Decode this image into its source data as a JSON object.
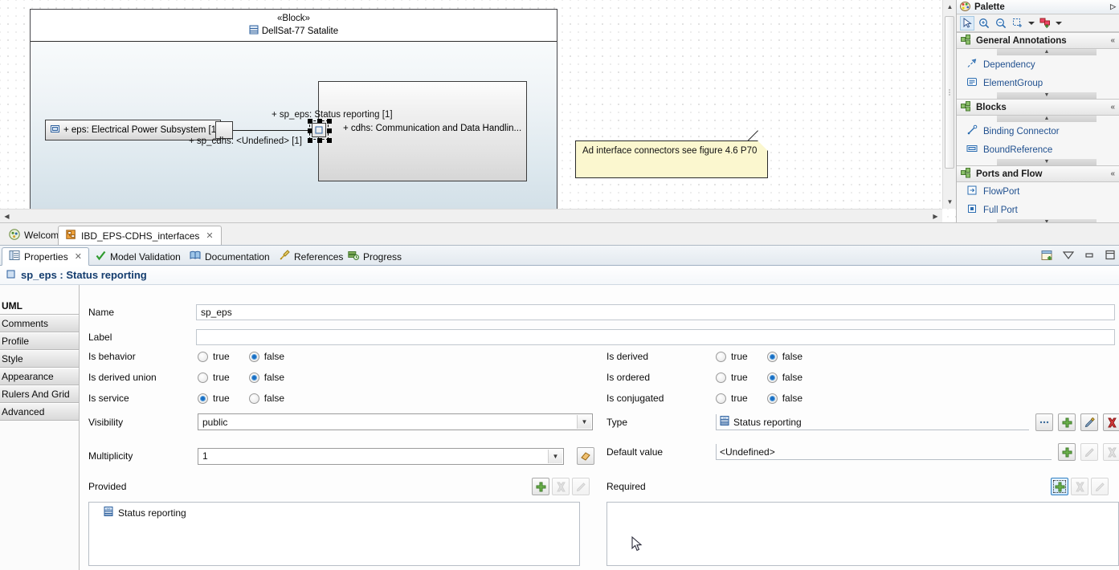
{
  "editor": {
    "diagram": {
      "block_stereotype": "«Block»",
      "block_name": "DellSat-77 Satalite",
      "parts": [
        {
          "label": "+ eps: Electrical Power Subsystem [1",
          "name": "eps"
        },
        {
          "label": "+ cdhs: Communication and Data Handlin...",
          "name": "cdhs"
        }
      ],
      "connector_labels": [
        "+ sp_eps: Status reporting [1]",
        "+ sp_cdhs: <Undefined> [1]"
      ],
      "note": "Ad interface connectors see figure 4.6 P70"
    },
    "tabs": [
      {
        "label": "Welcome",
        "icon": "welcome-icon",
        "active": false,
        "closable": false
      },
      {
        "label": "IBD_EPS-CDHS_interfaces",
        "icon": "diagram-icon",
        "active": true,
        "closable": true
      }
    ]
  },
  "palette": {
    "title": "Palette",
    "tools": [
      "select-tool",
      "zoom-in-tool",
      "zoom-out-tool",
      "marquee-tool",
      "marquee-dropdown",
      "format-tool",
      "format-dropdown"
    ],
    "sections": [
      {
        "title": "General Annotations",
        "items": [
          {
            "label": "Dependency",
            "icon": "dependency-icon"
          },
          {
            "label": "ElementGroup",
            "icon": "element-group-icon"
          }
        ]
      },
      {
        "title": "Blocks",
        "items": [
          {
            "label": "Binding Connector",
            "icon": "binding-connector-icon"
          },
          {
            "label": "BoundReference",
            "icon": "bound-reference-icon"
          }
        ]
      },
      {
        "title": "Ports and Flow",
        "items": [
          {
            "label": "FlowPort",
            "icon": "flow-port-icon"
          },
          {
            "label": "Full Port",
            "icon": "full-port-icon"
          }
        ]
      }
    ]
  },
  "properties": {
    "tabs": [
      {
        "label": "Properties",
        "icon": "properties-icon",
        "active": true,
        "closable": true
      },
      {
        "label": "Model Validation",
        "icon": "check-icon",
        "active": false,
        "closable": false
      },
      {
        "label": "Documentation",
        "icon": "book-icon",
        "active": false,
        "closable": false
      },
      {
        "label": "References",
        "icon": "references-icon",
        "active": false,
        "closable": false
      },
      {
        "label": "Progress",
        "icon": "progress-icon",
        "active": false,
        "closable": false
      }
    ],
    "view_tools": [
      "new-properties-view-icon",
      "view-menu-icon",
      "minimize-icon",
      "maximize-icon"
    ],
    "title": "sp_eps : Status reporting",
    "title_icon": "port-icon",
    "category_tabs": [
      {
        "label": "UML",
        "active": true
      },
      {
        "label": "Comments",
        "active": false
      },
      {
        "label": "Profile",
        "active": false
      },
      {
        "label": "Style",
        "active": false
      },
      {
        "label": "Appearance",
        "active": false
      },
      {
        "label": "Rulers And Grid",
        "active": false
      },
      {
        "label": "Advanced",
        "active": false
      }
    ],
    "fields": {
      "name": {
        "label": "Name",
        "value": "sp_eps"
      },
      "label": {
        "label": "Label",
        "value": ""
      },
      "is_behavior": {
        "label": "Is behavior",
        "true_label": "true",
        "false_label": "false",
        "value": "false"
      },
      "is_derived_union": {
        "label": "Is derived union",
        "true_label": "true",
        "false_label": "false",
        "value": "false"
      },
      "is_service": {
        "label": "Is service",
        "true_label": "true",
        "false_label": "false",
        "value": "true"
      },
      "visibility": {
        "label": "Visibility",
        "value": "public"
      },
      "multiplicity": {
        "label": "Multiplicity",
        "value": "1"
      },
      "is_derived": {
        "label": "Is derived",
        "true_label": "true",
        "false_label": "false",
        "value": "false"
      },
      "is_ordered": {
        "label": "Is ordered",
        "true_label": "true",
        "false_label": "false",
        "value": "false"
      },
      "is_conjugated": {
        "label": "Is conjugated",
        "true_label": "true",
        "false_label": "false",
        "value": "false"
      },
      "type": {
        "label": "Type",
        "value": "Status reporting",
        "icon": "interface-icon"
      },
      "default_value": {
        "label": "Default value",
        "value": "<Undefined>"
      }
    },
    "provided": {
      "label": "Provided",
      "items": [
        {
          "label": "Status reporting",
          "icon": "interface-icon"
        }
      ],
      "buttons": [
        "add-button",
        "delete-button",
        "edit-button"
      ]
    },
    "required": {
      "label": "Required",
      "items": [],
      "buttons": [
        "add-button",
        "delete-button",
        "edit-button"
      ]
    }
  },
  "colors": {
    "accent": "#133c6e",
    "link": "#20508f",
    "note_bg": "#fbf7cf",
    "radio_on": "#1a6fc4",
    "add_green": "#5ea832",
    "delete_red": "#cf2a2a"
  }
}
